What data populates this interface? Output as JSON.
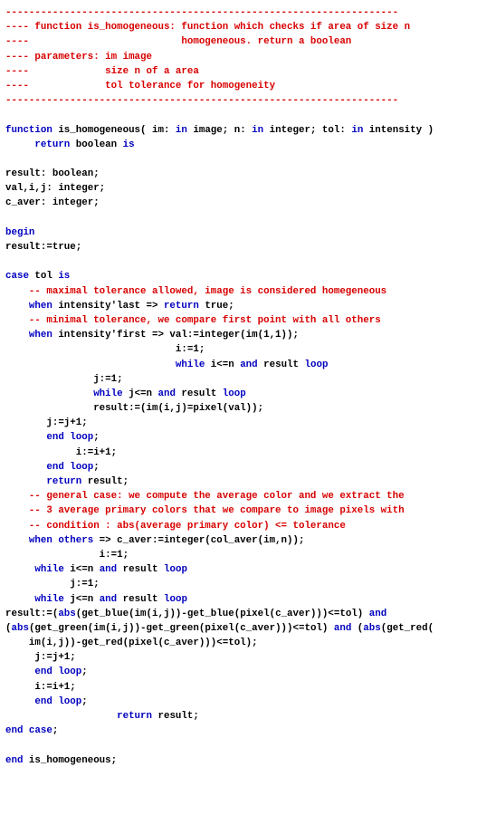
{
  "lines": [
    [
      {
        "type": "comment",
        "text": "-------------------------------------------------------------------"
      }
    ],
    [
      {
        "type": "comment",
        "text": "---- function is_homogeneous: function which checks if area of size n"
      }
    ],
    [
      {
        "type": "comment",
        "text": "----                          homogeneous. return a boolean"
      }
    ],
    [
      {
        "type": "comment",
        "text": "---- parameters: im image"
      }
    ],
    [
      {
        "type": "comment",
        "text": "----             size n of a area"
      }
    ],
    [
      {
        "type": "comment",
        "text": "----             tol tolerance for homogeneity"
      }
    ],
    [
      {
        "type": "comment",
        "text": "-------------------------------------------------------------------"
      }
    ],
    [
      {
        "type": "normal",
        "text": ""
      }
    ],
    [
      {
        "type": "keyword",
        "text": "function"
      },
      {
        "type": "normal",
        "text": " is_homogeneous( im: "
      },
      {
        "type": "keyword",
        "text": "in"
      },
      {
        "type": "normal",
        "text": " image; n: "
      },
      {
        "type": "keyword",
        "text": "in"
      },
      {
        "type": "normal",
        "text": " integer; tol: "
      },
      {
        "type": "keyword",
        "text": "in"
      },
      {
        "type": "normal",
        "text": " intensity )"
      }
    ],
    [
      {
        "type": "normal",
        "text": "     "
      },
      {
        "type": "keyword",
        "text": "return"
      },
      {
        "type": "normal",
        "text": " boolean "
      },
      {
        "type": "keyword",
        "text": "is"
      }
    ],
    [
      {
        "type": "normal",
        "text": ""
      }
    ],
    [
      {
        "type": "normal",
        "text": "result: boolean;"
      }
    ],
    [
      {
        "type": "normal",
        "text": "val,i,j: integer;"
      }
    ],
    [
      {
        "type": "normal",
        "text": "c_aver: integer;"
      }
    ],
    [
      {
        "type": "normal",
        "text": ""
      }
    ],
    [
      {
        "type": "keyword",
        "text": "begin"
      }
    ],
    [
      {
        "type": "normal",
        "text": "result:=true;"
      }
    ],
    [
      {
        "type": "normal",
        "text": ""
      }
    ],
    [
      {
        "type": "keyword",
        "text": "case"
      },
      {
        "type": "normal",
        "text": " tol "
      },
      {
        "type": "keyword",
        "text": "is"
      }
    ],
    [
      {
        "type": "normal",
        "text": "    "
      },
      {
        "type": "comment",
        "text": "-- maximal tolerance allowed, image is considered homegeneous"
      }
    ],
    [
      {
        "type": "normal",
        "text": "    "
      },
      {
        "type": "keyword",
        "text": "when"
      },
      {
        "type": "normal",
        "text": " intensity'last => "
      },
      {
        "type": "keyword",
        "text": "return"
      },
      {
        "type": "normal",
        "text": " true;"
      }
    ],
    [
      {
        "type": "normal",
        "text": "    "
      },
      {
        "type": "comment",
        "text": "-- minimal tolerance, we compare first point with all others"
      }
    ],
    [
      {
        "type": "normal",
        "text": "    "
      },
      {
        "type": "keyword",
        "text": "when"
      },
      {
        "type": "normal",
        "text": " intensity'first => val:=integer(im(1,1));"
      }
    ],
    [
      {
        "type": "normal",
        "text": "                             i:=1;"
      }
    ],
    [
      {
        "type": "normal",
        "text": "                             "
      },
      {
        "type": "keyword",
        "text": "while"
      },
      {
        "type": "normal",
        "text": " i<=n "
      },
      {
        "type": "keyword",
        "text": "and"
      },
      {
        "type": "normal",
        "text": " result "
      },
      {
        "type": "keyword",
        "text": "loop"
      }
    ],
    [
      {
        "type": "normal",
        "text": "               j:=1;"
      }
    ],
    [
      {
        "type": "normal",
        "text": "               "
      },
      {
        "type": "keyword",
        "text": "while"
      },
      {
        "type": "normal",
        "text": " j<=n "
      },
      {
        "type": "keyword",
        "text": "and"
      },
      {
        "type": "normal",
        "text": " result "
      },
      {
        "type": "keyword",
        "text": "loop"
      }
    ],
    [
      {
        "type": "normal",
        "text": "               result:=(im(i,j)=pixel(val));"
      }
    ],
    [
      {
        "type": "normal",
        "text": "       j:=j+1;"
      }
    ],
    [
      {
        "type": "normal",
        "text": "       "
      },
      {
        "type": "keyword",
        "text": "end loop"
      },
      {
        "type": "normal",
        "text": ";"
      }
    ],
    [
      {
        "type": "normal",
        "text": "            i:=i+1;"
      }
    ],
    [
      {
        "type": "normal",
        "text": "       "
      },
      {
        "type": "keyword",
        "text": "end loop"
      },
      {
        "type": "normal",
        "text": ";"
      }
    ],
    [
      {
        "type": "normal",
        "text": "       "
      },
      {
        "type": "keyword",
        "text": "return"
      },
      {
        "type": "normal",
        "text": " result;"
      }
    ],
    [
      {
        "type": "normal",
        "text": "    "
      },
      {
        "type": "comment",
        "text": "-- general case: we compute the average color and we extract the"
      }
    ],
    [
      {
        "type": "normal",
        "text": "    "
      },
      {
        "type": "comment",
        "text": "-- 3 average primary colors that we compare to image pixels with"
      }
    ],
    [
      {
        "type": "normal",
        "text": "    "
      },
      {
        "type": "comment",
        "text": "-- condition : abs(average primary color) <= tolerance"
      }
    ],
    [
      {
        "type": "normal",
        "text": "    "
      },
      {
        "type": "keyword",
        "text": "when others"
      },
      {
        "type": "normal",
        "text": " => c_aver:=integer(col_aver(im,n));"
      }
    ],
    [
      {
        "type": "normal",
        "text": "                i:=1;"
      }
    ],
    [
      {
        "type": "normal",
        "text": "     "
      },
      {
        "type": "keyword",
        "text": "while"
      },
      {
        "type": "normal",
        "text": " i<=n "
      },
      {
        "type": "keyword",
        "text": "and"
      },
      {
        "type": "normal",
        "text": " result "
      },
      {
        "type": "keyword",
        "text": "loop"
      }
    ],
    [
      {
        "type": "normal",
        "text": "           j:=1;"
      }
    ],
    [
      {
        "type": "normal",
        "text": "     "
      },
      {
        "type": "keyword",
        "text": "while"
      },
      {
        "type": "normal",
        "text": " j<=n "
      },
      {
        "type": "keyword",
        "text": "and"
      },
      {
        "type": "normal",
        "text": " result "
      },
      {
        "type": "keyword",
        "text": "loop"
      }
    ],
    [
      {
        "type": "normal",
        "text": "result:=("
      },
      {
        "type": "keyword",
        "text": "abs"
      },
      {
        "type": "normal",
        "text": "(get_blue(im(i,j))-get_blue(pixel(c_aver)))<=tol) "
      },
      {
        "type": "keyword",
        "text": "and"
      }
    ],
    [
      {
        "type": "normal",
        "text": "("
      },
      {
        "type": "keyword",
        "text": "abs"
      },
      {
        "type": "normal",
        "text": "(get_green(im(i,j))-get_green(pixel(c_aver)))<=tol) "
      },
      {
        "type": "keyword",
        "text": "and"
      },
      {
        "type": "normal",
        "text": " ("
      },
      {
        "type": "keyword",
        "text": "abs"
      },
      {
        "type": "normal",
        "text": "(get_red("
      }
    ],
    [
      {
        "type": "normal",
        "text": "    im(i,j))-get_red(pixel(c_aver)))<=tol);"
      }
    ],
    [
      {
        "type": "normal",
        "text": "     j:=j+1;"
      }
    ],
    [
      {
        "type": "normal",
        "text": "     "
      },
      {
        "type": "keyword",
        "text": "end loop"
      },
      {
        "type": "normal",
        "text": ";"
      }
    ],
    [
      {
        "type": "normal",
        "text": "     i:=i+1;"
      }
    ],
    [
      {
        "type": "normal",
        "text": "     "
      },
      {
        "type": "keyword",
        "text": "end loop"
      },
      {
        "type": "normal",
        "text": ";"
      }
    ],
    [
      {
        "type": "normal",
        "text": "                   "
      },
      {
        "type": "keyword",
        "text": "return"
      },
      {
        "type": "normal",
        "text": " result;"
      }
    ],
    [
      {
        "type": "keyword",
        "text": "end case"
      },
      {
        "type": "normal",
        "text": ";"
      }
    ],
    [
      {
        "type": "normal",
        "text": ""
      }
    ],
    [
      {
        "type": "keyword",
        "text": "end"
      },
      {
        "type": "normal",
        "text": " is_homogeneous;"
      }
    ]
  ]
}
